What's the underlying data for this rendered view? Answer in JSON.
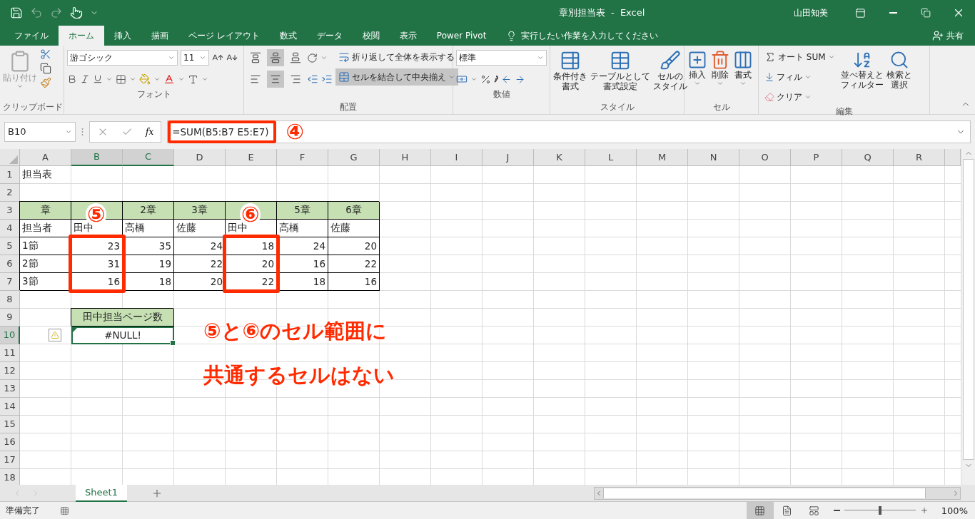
{
  "title_bar": {
    "title": "章別担当表  -  Excel",
    "user": "山田知美"
  },
  "ribbon_tabs": [
    {
      "label": "ファイル",
      "selected": false
    },
    {
      "label": "ホーム",
      "selected": true
    },
    {
      "label": "挿入",
      "selected": false
    },
    {
      "label": "描画",
      "selected": false
    },
    {
      "label": "ページ レイアウト",
      "selected": false
    },
    {
      "label": "数式",
      "selected": false
    },
    {
      "label": "データ",
      "selected": false
    },
    {
      "label": "校閲",
      "selected": false
    },
    {
      "label": "表示",
      "selected": false
    },
    {
      "label": "Power Pivot",
      "selected": false
    }
  ],
  "tell_me": {
    "placeholder": "実行したい作業を入力してください"
  },
  "share": "共有",
  "ribbon": {
    "clipboard": {
      "paste": "貼り付け",
      "label": "クリップボード"
    },
    "font": {
      "font_name": "游ゴシック",
      "font_size": "11",
      "label": "フォント"
    },
    "alignment": {
      "vertical_align": [
        {
          "selected": false
        },
        {
          "selected": true
        },
        {
          "selected": false
        }
      ],
      "horizontal_align": [
        {
          "selected": false
        },
        {
          "selected": true
        },
        {
          "selected": false
        }
      ],
      "wrap_text": "折り返して全体を表示する",
      "merge": {
        "label": "セルを結合して中央揃え",
        "selected": true
      },
      "label": "配置"
    },
    "number": {
      "format": "標準",
      "label": "数値"
    },
    "styles": {
      "buttons": [
        {
          "lines": [
            "条件付き",
            "書式"
          ]
        },
        {
          "lines": [
            "テーブルとして",
            "書式設定"
          ]
        },
        {
          "lines": [
            "セルの",
            "スタイル"
          ]
        }
      ],
      "label": "スタイル"
    },
    "cells": {
      "buttons": [
        {
          "lines": [
            "挿入"
          ]
        },
        {
          "lines": [
            "削除"
          ]
        },
        {
          "lines": [
            "書式"
          ]
        }
      ],
      "label": "セル"
    },
    "editing": {
      "autosum": "オート SUM",
      "fill": "フィル",
      "clear": "クリア",
      "buttons": [
        {
          "lines": [
            "並べ替えと",
            "フィルター"
          ]
        },
        {
          "lines": [
            "検索と",
            "選択"
          ]
        }
      ],
      "label": "編集"
    }
  },
  "formula_bar": {
    "name_box": "B10",
    "function_button": "fx",
    "formula": "=SUM(B5:B7 E5:E7)",
    "marker": "④"
  },
  "sheet": {
    "columns": [
      {
        "label": "A",
        "selected": false
      },
      {
        "label": "B",
        "selected": true
      },
      {
        "label": "C",
        "selected": true
      },
      {
        "label": "D",
        "selected": false
      },
      {
        "label": "E",
        "selected": false
      },
      {
        "label": "F",
        "selected": false
      },
      {
        "label": "G",
        "selected": false
      },
      {
        "label": "H",
        "selected": false
      },
      {
        "label": "I",
        "selected": false
      },
      {
        "label": "J",
        "selected": false
      },
      {
        "label": "K",
        "selected": false
      },
      {
        "label": "L",
        "selected": false
      },
      {
        "label": "M",
        "selected": false
      },
      {
        "label": "N",
        "selected": false
      },
      {
        "label": "O",
        "selected": false
      },
      {
        "label": "P",
        "selected": false
      },
      {
        "label": "Q",
        "selected": false
      },
      {
        "label": "R",
        "selected": false
      }
    ],
    "rows": [
      {
        "label": "1",
        "selected": false,
        "cells": [
          {
            "kind": "plain",
            "text": "担当表"
          }
        ]
      },
      {
        "label": "2",
        "selected": false
      },
      {
        "label": "3",
        "selected": false,
        "cells": [
          {
            "kind": "heading",
            "text": "章"
          },
          {
            "kind": "heading"
          },
          {
            "kind": "heading",
            "text": "2章"
          },
          {
            "kind": "heading",
            "text": "3章"
          },
          {
            "kind": "heading"
          },
          {
            "kind": "heading",
            "text": "5章"
          },
          {
            "kind": "heading",
            "text": "6章"
          }
        ]
      },
      {
        "label": "4",
        "selected": false,
        "cells": [
          {
            "kind": "text",
            "text": "担当者"
          },
          {
            "kind": "text",
            "text": "田中"
          },
          {
            "kind": "text",
            "text": "高橋"
          },
          {
            "kind": "text",
            "text": "佐藤"
          },
          {
            "kind": "text",
            "text": "田中"
          },
          {
            "kind": "text",
            "text": "高橋"
          },
          {
            "kind": "text",
            "text": "佐藤"
          }
        ]
      },
      {
        "label": "5",
        "selected": false,
        "cells": [
          {
            "kind": "text",
            "text": "1節"
          },
          {
            "kind": "number",
            "text": "23"
          },
          {
            "kind": "number",
            "text": "35"
          },
          {
            "kind": "number",
            "text": "24"
          },
          {
            "kind": "number",
            "text": "18"
          },
          {
            "kind": "number",
            "text": "24"
          },
          {
            "kind": "number",
            "text": "20"
          }
        ]
      },
      {
        "label": "6",
        "selected": false,
        "cells": [
          {
            "kind": "text",
            "text": "2節"
          },
          {
            "kind": "number",
            "text": "31"
          },
          {
            "kind": "number",
            "text": "19"
          },
          {
            "kind": "number",
            "text": "22"
          },
          {
            "kind": "number",
            "text": "20"
          },
          {
            "kind": "number",
            "text": "16"
          },
          {
            "kind": "number",
            "text": "22"
          }
        ]
      },
      {
        "label": "7",
        "selected": false,
        "cells": [
          {
            "kind": "text",
            "text": "3節"
          },
          {
            "kind": "number",
            "text": "16"
          },
          {
            "kind": "number",
            "text": "18"
          },
          {
            "kind": "number",
            "text": "20"
          },
          {
            "kind": "number",
            "text": "22"
          },
          {
            "kind": "number",
            "text": "18"
          },
          {
            "kind": "number",
            "text": "16"
          }
        ]
      },
      {
        "label": "8",
        "selected": false
      },
      {
        "label": "9",
        "selected": false,
        "cells": [
          {
            "kind": "empty"
          },
          {
            "kind": "caption",
            "text": "田中担当ページ数"
          }
        ]
      },
      {
        "label": "10",
        "selected": true,
        "cells": [
          {
            "kind": "warning"
          },
          {
            "kind": "result",
            "text": "#NULL!",
            "selected": true
          }
        ]
      },
      {
        "label": "11",
        "selected": false
      },
      {
        "label": "12",
        "selected": false
      },
      {
        "label": "13",
        "selected": false
      },
      {
        "label": "14",
        "selected": false
      },
      {
        "label": "15",
        "selected": false
      },
      {
        "label": "16",
        "selected": false
      },
      {
        "label": "17",
        "selected": false
      },
      {
        "label": "18",
        "selected": false
      }
    ],
    "range_markers": [
      "⑤",
      "⑥"
    ],
    "note": [
      "⑤と⑥のセル範囲に",
      "共通するセルはない"
    ]
  },
  "sheet_tabs": [
    {
      "label": "Sheet1",
      "selected": true
    }
  ],
  "status_bar": {
    "status": "準備完了",
    "views": [
      {
        "selected": true
      },
      {
        "selected": false
      },
      {
        "selected": false
      }
    ],
    "zoom": {
      "level": 0.5,
      "reading": "100%"
    }
  }
}
